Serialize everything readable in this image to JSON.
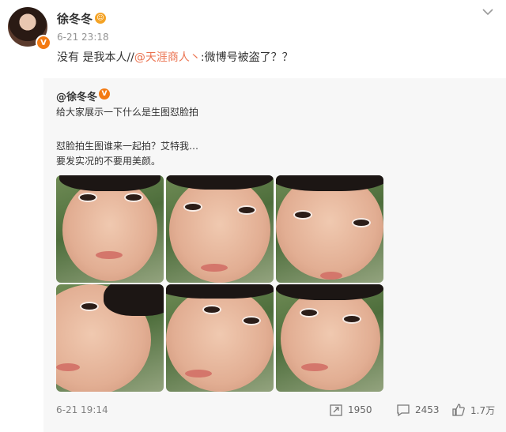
{
  "post": {
    "author": "徐冬冬",
    "time": "6-21 23:18",
    "text_prefix": "没有 是我本人//",
    "mention": "@天涯商人丶",
    "text_suffix": ":微博号被盗了？？"
  },
  "repost": {
    "author": "@徐冬冬",
    "lines": [
      "给大家展示一下什么是生图怼脸拍",
      "怼脸拍生图谁来一起拍？艾特我…",
      "要发实况的不要用美颜。"
    ],
    "time": "6-21 19:14",
    "reposts": "1950",
    "comments": "2453",
    "likes": "1.7万"
  },
  "colors": {
    "mention": "#eb7350",
    "badge": "#f37a12",
    "muted": "#939393"
  },
  "icons": [
    "vip-badge-icon",
    "emoji-badge-icon",
    "chevron-down-icon",
    "share-icon",
    "comment-icon",
    "like-icon"
  ]
}
